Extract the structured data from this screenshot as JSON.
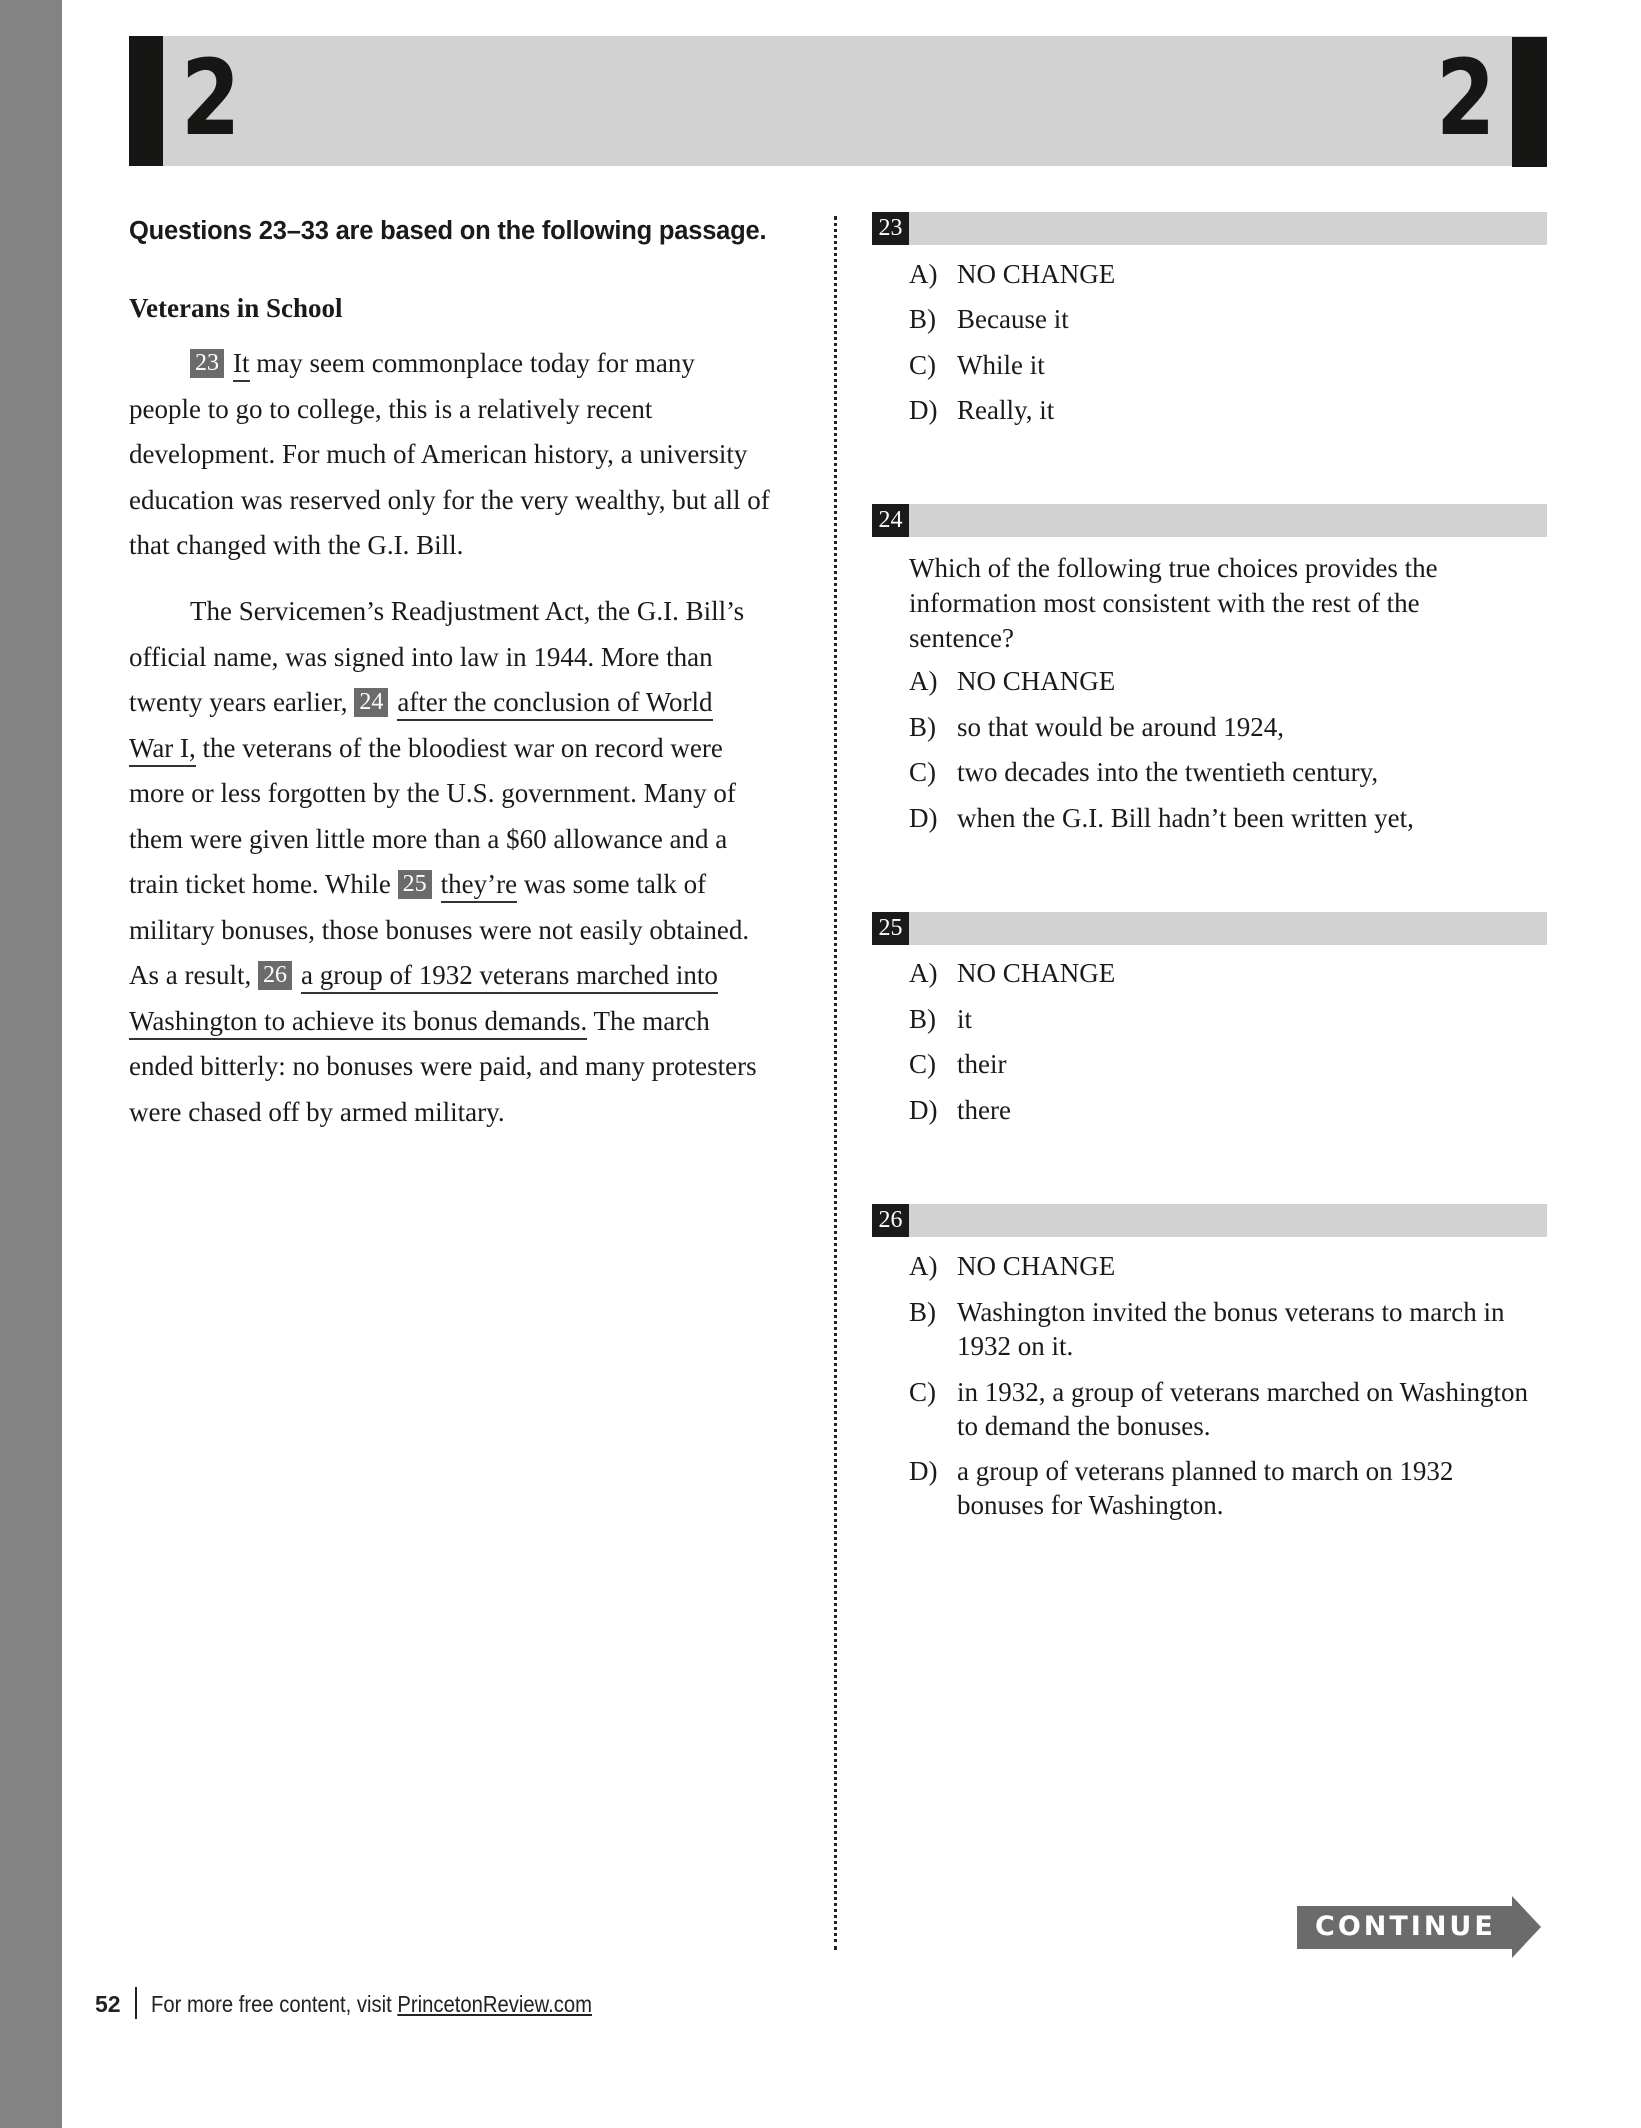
{
  "header": {
    "section_left": "2",
    "section_right": "2"
  },
  "intro": "Questions 23–33 are based on the following passage.",
  "passage": {
    "title": "Veterans in School",
    "lines": [
      {
        "pre": "",
        "box": "23",
        "ul": "It",
        "post": " may seem commonplace today for many"
      },
      {
        "pre": "people to go to college, this is a relatively recent"
      },
      {
        "pre": "development. For much of American history, a university"
      },
      {
        "pre": "education was reserved only for the very wealthy, but all of"
      },
      {
        "pre": "that changed with the G.I. Bill."
      },
      {
        "pre": "The Servicemen’s Readjustment Act, the G.I. Bill’s"
      },
      {
        "pre": "official name, was signed into law in 1944. More than"
      },
      {
        "pre": "twenty years earlier, ",
        "box": "24",
        "ul": "after the conclusion of World",
        "post": ""
      },
      {
        "pre": "",
        "ul": "War I,",
        "post": " the veterans of the bloodiest war on record were"
      },
      {
        "pre": "more or less forgotten by the U.S. government. Many of"
      },
      {
        "pre": "them were given little more than a $60 allowance and a"
      },
      {
        "pre": "train ticket home. While ",
        "box": "25",
        "ul": "they’re",
        "post": " was some talk of"
      },
      {
        "pre": "military bonuses, those bonuses were not easily obtained."
      },
      {
        "pre": "As a result, ",
        "box": "26",
        "ul": "a group of 1932 veterans marched into",
        "post": ""
      },
      {
        "pre": "",
        "ul": "Washington to achieve its bonus demands.",
        "post": " The march"
      },
      {
        "pre": "ended bitterly: no bonuses were paid, and many protesters"
      },
      {
        "pre": "were chased off by armed military."
      }
    ]
  },
  "questions": [
    {
      "number": "23",
      "prompt": "",
      "choices": [
        {
          "letter": "A)",
          "text": "NO CHANGE"
        },
        {
          "letter": "B)",
          "text": "Because it"
        },
        {
          "letter": "C)",
          "text": "While it"
        },
        {
          "letter": "D)",
          "text": "Really, it"
        }
      ]
    },
    {
      "number": "24",
      "prompt": "Which of the following true choices provides the information most consistent with the rest of the sentence?",
      "choices": [
        {
          "letter": "A)",
          "text": "NO CHANGE"
        },
        {
          "letter": "B)",
          "text": "so that would be around 1924,"
        },
        {
          "letter": "C)",
          "text": "two decades into the twentieth century,"
        },
        {
          "letter": "D)",
          "text": "when the G.I. Bill hadn’t been written yet,"
        }
      ]
    },
    {
      "number": "25",
      "prompt": "",
      "choices": [
        {
          "letter": "A)",
          "text": "NO CHANGE"
        },
        {
          "letter": "B)",
          "text": "it"
        },
        {
          "letter": "C)",
          "text": "their"
        },
        {
          "letter": "D)",
          "text": "there"
        }
      ]
    },
    {
      "number": "26",
      "prompt": "",
      "choices": [
        {
          "letter": "A)",
          "text": "NO CHANGE"
        },
        {
          "letter": "B)",
          "text": "Washington invited the bonus veterans to march in 1932 on it."
        },
        {
          "letter": "C)",
          "text": "in 1932, a group of veterans marched on Washington to demand the bonuses."
        },
        {
          "letter": "D)",
          "text": "a group of veterans planned to march on 1932 bonuses for Washington."
        }
      ]
    }
  ],
  "continue_label": "CONTINUE",
  "footer": {
    "page_number": "52",
    "text": "For more free content, visit ",
    "link": "PrincetonReview.com"
  },
  "colors": {
    "side_band": "#838383",
    "banner": "#d2d2d2",
    "black_bar": "#161614",
    "inline_box": "#6b6b6b",
    "continue": "#6b6b6b"
  }
}
